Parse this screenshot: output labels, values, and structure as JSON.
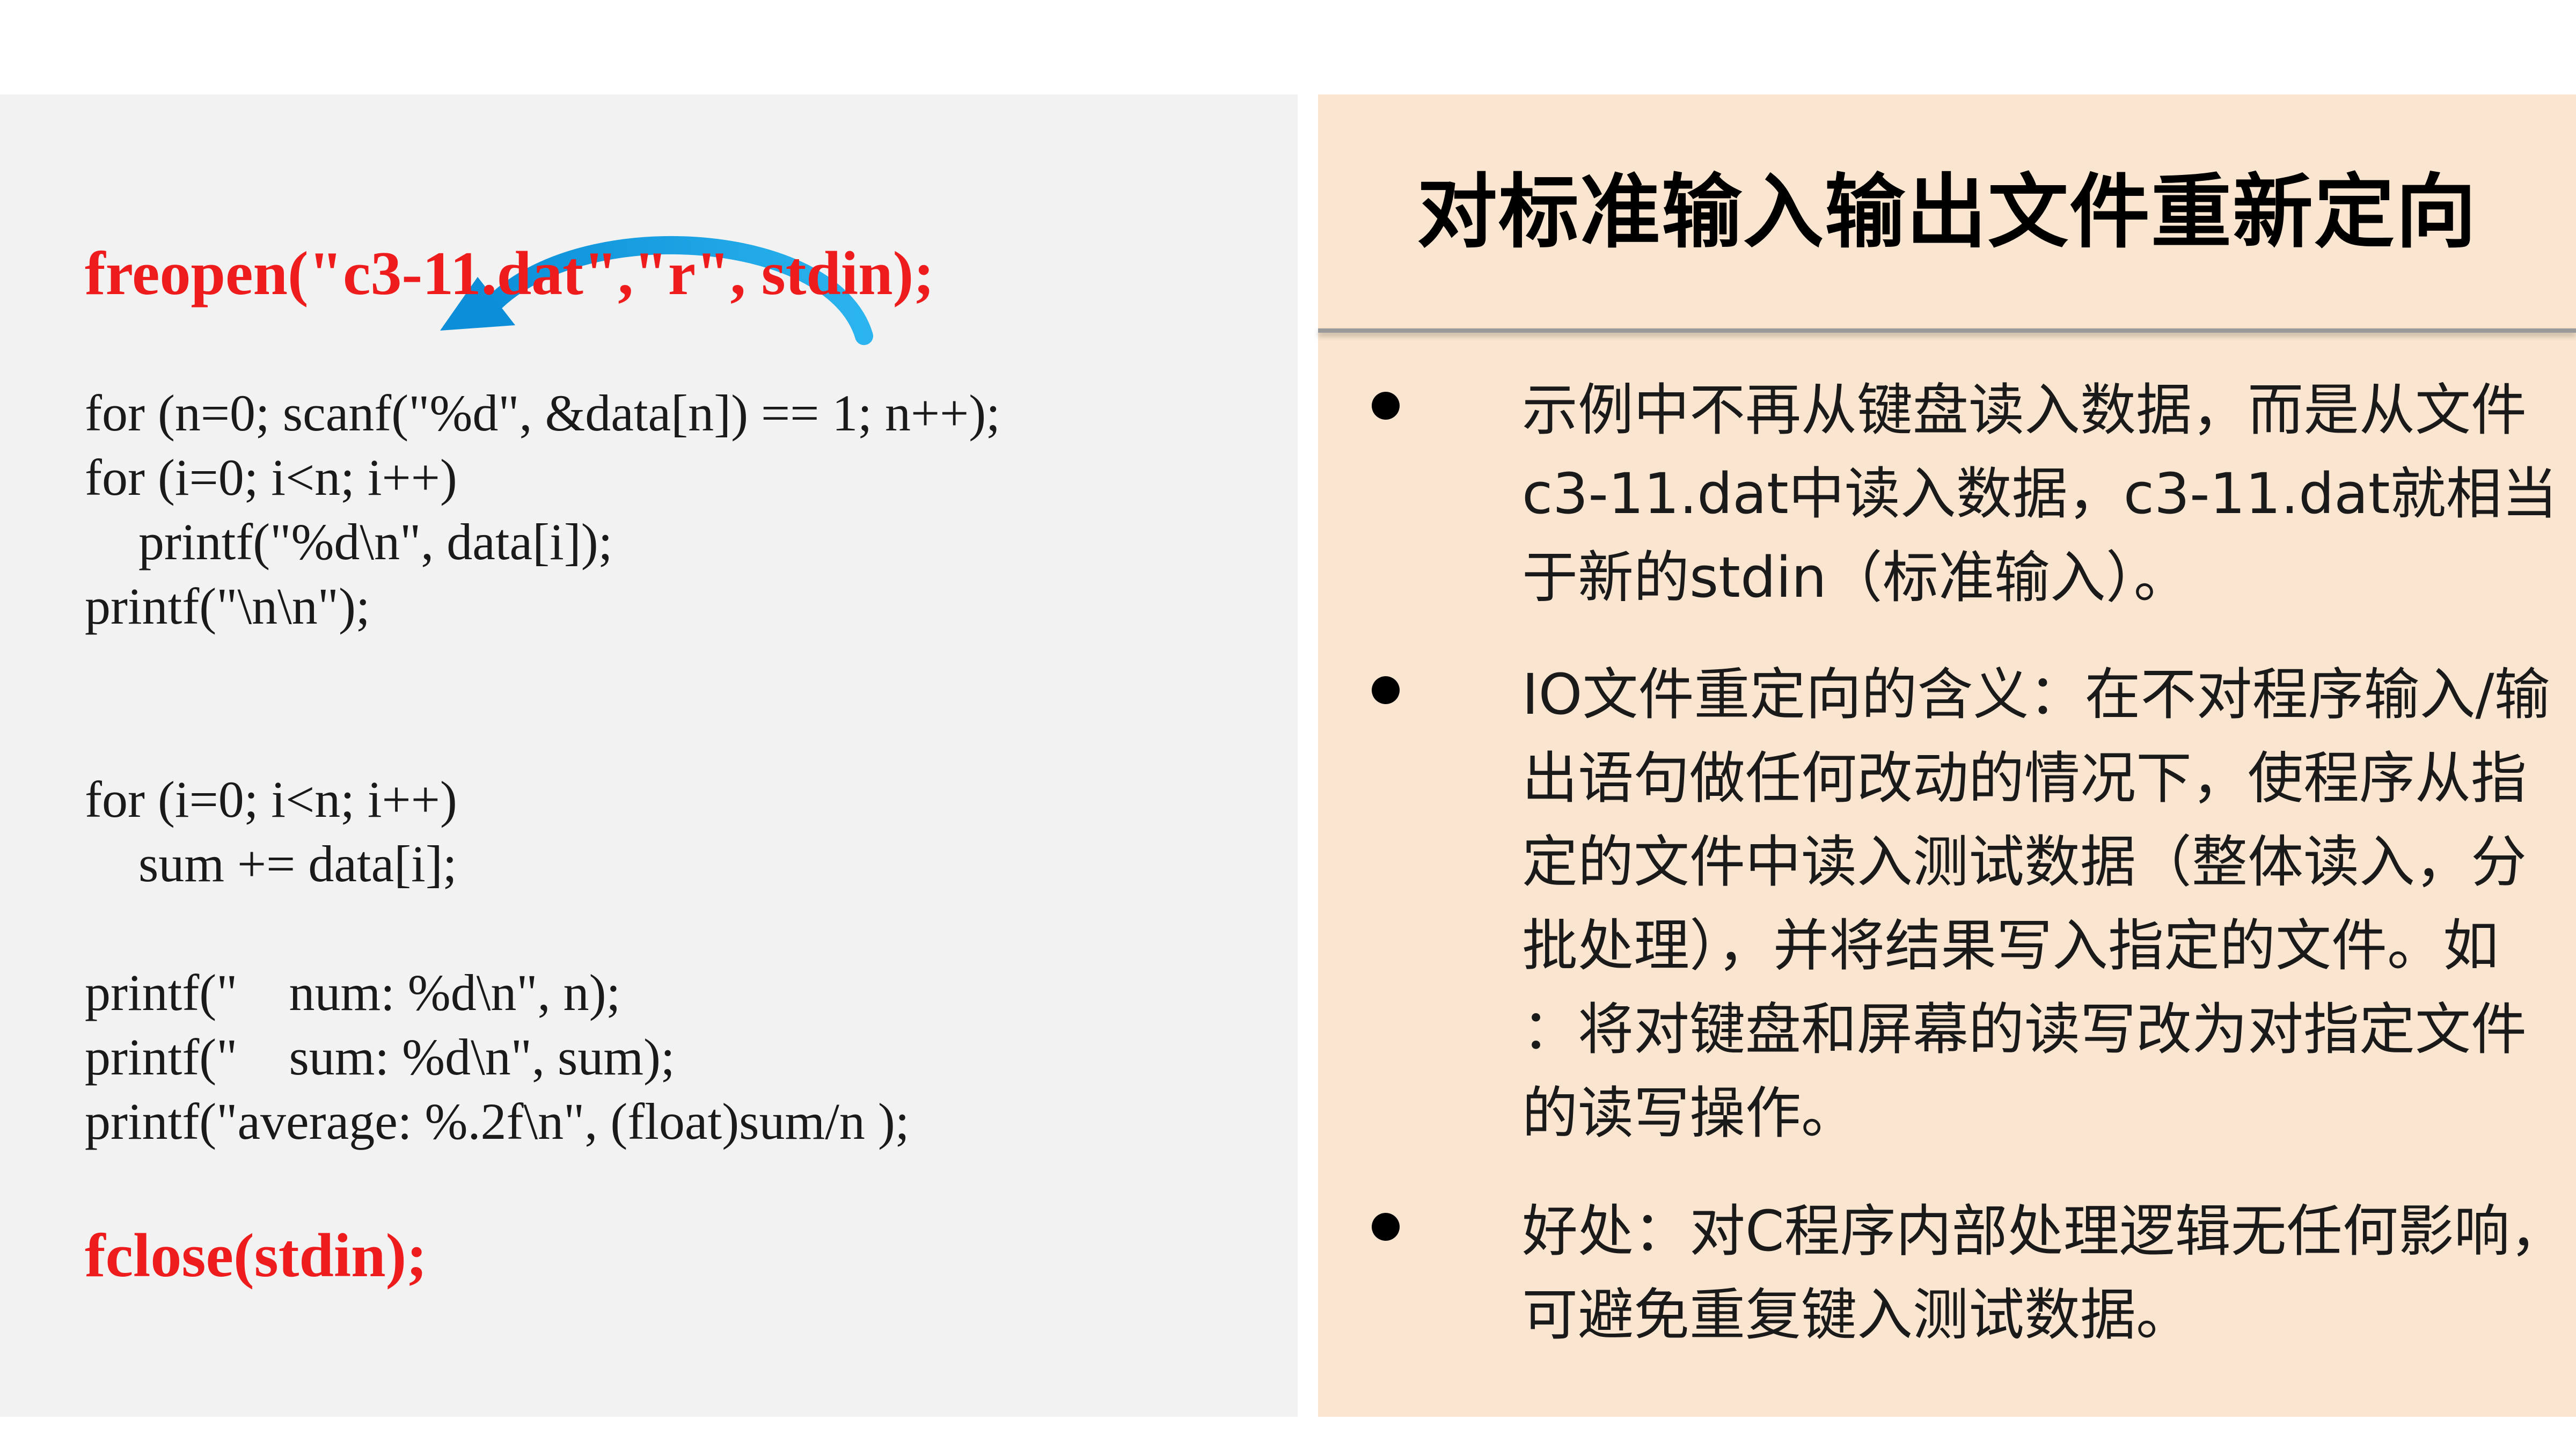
{
  "code_panel": {
    "freopen_line": "freopen(\"c3-11.dat\",\"r\", stdin);",
    "lines": [
      "for (n=0; scanf(\"%d\", &data[n]) == 1; n++);",
      "for (i=0; i<n; i++)",
      "printf(\"%d\\n\", data[i]);",
      "printf(\"\\n\\n\");",
      "for (i=0; i<n; i++)",
      "sum += data[i];",
      "printf(\"    num: %d\\n\", n);",
      "printf(\"    sum: %d\\n\", sum);",
      "printf(\"average: %.2f\\n\", (float)sum/n );"
    ],
    "fclose_line": "fclose(stdin);"
  },
  "explain_panel": {
    "title": "对标准输入输出文件重新定向",
    "bullets": [
      {
        "lines": [
          "示例中不再从键盘读入数据，而是从文件",
          "c3-11.dat中读入数据，c3-11.dat就相当",
          "于新的stdin（标准输入）。"
        ]
      },
      {
        "lines": [
          "IO文件重定向的含义：在不对程序输入/输",
          "出语句做任何改动的情况下，使程序从指",
          "定的文件中读入测试数据（整体读入，分",
          "批处理），并将结果写入指定的文件。如",
          "：将对键盘和屏幕的读写改为对指定文件",
          "的读写操作。"
        ]
      },
      {
        "lines": [
          "好处：对C程序内部处理逻辑无任何影响，",
          "可避免重复键入测试数据。"
        ]
      }
    ]
  },
  "colors": {
    "code_panel_bg": "#f2f2f2",
    "explain_panel_bg": "#fae6d0",
    "emphasis_red": "#ee1c1c",
    "arrow_blue": "#1aa3e8"
  },
  "icons": {
    "arrow": "curved-arrow-icon",
    "bullet": "bullet-dot-icon"
  }
}
